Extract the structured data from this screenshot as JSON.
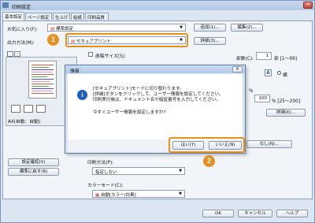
{
  "window": {
    "title": "印刷設定"
  },
  "tabs": [
    {
      "label": "基本設定"
    },
    {
      "label": "ページ設定"
    },
    {
      "label": "仕上げ"
    },
    {
      "label": "給紙"
    },
    {
      "label": "印刷品質"
    }
  ],
  "favorites": {
    "label": "お気に入り(F):",
    "value": "標準設定",
    "add_label": "追加(1)...",
    "edit_label": "編集(2)..."
  },
  "output_method": {
    "label": "出力方法(M):",
    "value": "セキュアプリント",
    "details_label": "詳細(3)..."
  },
  "paper_size": {
    "label": "原稿サイズ(S):"
  },
  "copies": {
    "label": "部数(C):",
    "value": "1",
    "range": "部 [1〜99]"
  },
  "orientation": {
    "option_a": "A",
    "option_b": "横"
  },
  "left_buttons": {
    "settings_check": "設定確認(V)",
    "restore_default": "標準に戻す(R)"
  },
  "preview_caption": "A4(自動：自動)",
  "right_misc": {
    "percent": "%",
    "range": "% [25〜200]",
    "sub_button": "詳細(K)...",
    "truncated_btn": "なし(N)..."
  },
  "quality": {
    "label": "印刷方法(P):",
    "value": "指定しない"
  },
  "color_mode": {
    "label": "カラーモード(C):",
    "value": "自動[カラー/白黒]"
  },
  "footer": {
    "ok": "OK",
    "cancel": "キャンセル",
    "help": "ヘルプ"
  },
  "dialog": {
    "title": "情報",
    "lines": [
      "[セキュアプリント]モードに切り替わります。",
      "[詳細]ボタンをクリックして、ユーザー情報を設定してください。",
      "印刷実行後は、ドキュメント名や暗証番号を入力してください。"
    ],
    "question": "今すぐユーザー情報を設定しますか?",
    "yes_label": "はい(Y)",
    "no_label": "いいえ(N)"
  },
  "callouts": {
    "one": "1",
    "two": "2"
  },
  "colors": {
    "accent_orange": "#e5901f",
    "info_blue": "#1f5fbf"
  }
}
